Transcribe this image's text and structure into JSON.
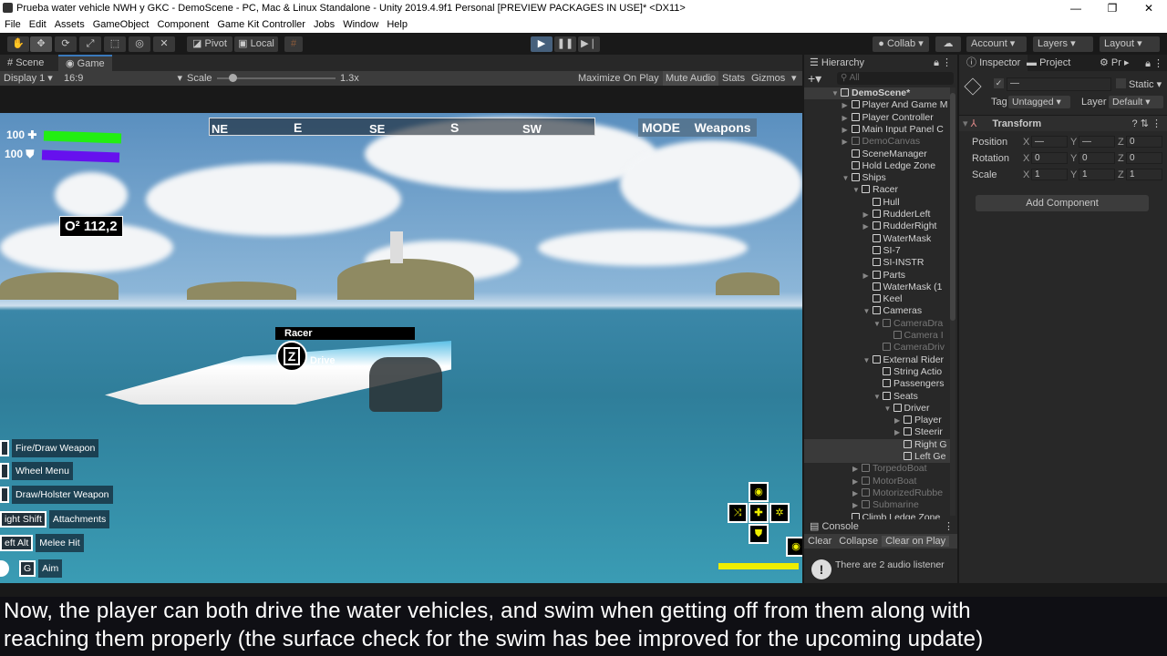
{
  "window": {
    "title": "Prueba water vehicle NWH y GKC - DemoScene - PC, Mac & Linux Standalone - Unity 2019.4.9f1 Personal [PREVIEW PACKAGES IN USE]* <DX11>",
    "minimize": "—",
    "maximize": "❐",
    "close": "✕"
  },
  "menu": [
    "File",
    "Edit",
    "Assets",
    "GameObject",
    "Component",
    "Game Kit Controller",
    "Jobs",
    "Window",
    "Help"
  ],
  "toolbar": {
    "pivot": "Pivot",
    "local": "Local",
    "collab": "Collab",
    "account": "Account",
    "layers": "Layers",
    "layout": "Layout"
  },
  "tabs": {
    "scene": "Scene",
    "game": "Game"
  },
  "gamebar": {
    "display": "Display 1",
    "aspect": "16:9",
    "scale_label": "Scale",
    "scale_value": "1.3x",
    "scale_fraction": 0.1,
    "maximize": "Maximize On Play",
    "mute": "Mute Audio",
    "stats": "Stats",
    "gizmos": "Gizmos"
  },
  "hud": {
    "health": "100",
    "shield": "100",
    "health_fill": 1.0,
    "shield_fill": 1.0,
    "oxygen": "O² 112,2",
    "compass": [
      "NE",
      "E",
      "SE",
      "S",
      "SW"
    ],
    "mode_label": "MODE",
    "mode_value": "Weapons",
    "vehicle_name": "Racer",
    "interact_key": "Z",
    "interact_label": "Drive",
    "hints": [
      {
        "key": "",
        "label": "Fire/Draw Weapon"
      },
      {
        "key": "",
        "label": "Wheel Menu"
      },
      {
        "key": "",
        "label": "Draw/Holster Weapon"
      },
      {
        "key": "ight Shift",
        "label": "Attachments"
      },
      {
        "key": "eft Alt",
        "label": "Melee Hit"
      },
      {
        "key": "G",
        "label": "Aim"
      }
    ],
    "colors": {
      "health": "#22ee11",
      "shield": "#6611ee",
      "stamina": "#eeee00"
    }
  },
  "hierarchy": {
    "title": "Hierarchy",
    "search": "All",
    "items": [
      {
        "label": "DemoScene*",
        "depth": 0,
        "arrow": "▼",
        "dim": false
      },
      {
        "label": "Player And Game M",
        "depth": 1,
        "arrow": "▶"
      },
      {
        "label": "Player Controller",
        "depth": 1,
        "arrow": "▶"
      },
      {
        "label": "Main Input Panel C",
        "depth": 1,
        "arrow": "▶"
      },
      {
        "label": "DemoCanvas",
        "depth": 1,
        "arrow": "▶",
        "dim": true
      },
      {
        "label": "SceneManager",
        "depth": 1,
        "arrow": ""
      },
      {
        "label": "Hold Ledge Zone",
        "depth": 1,
        "arrow": ""
      },
      {
        "label": "Ships",
        "depth": 1,
        "arrow": "▼"
      },
      {
        "label": "Racer",
        "depth": 2,
        "arrow": "▼"
      },
      {
        "label": "Hull",
        "depth": 3,
        "arrow": ""
      },
      {
        "label": "RudderLeft",
        "depth": 3,
        "arrow": "▶"
      },
      {
        "label": "RudderRight",
        "depth": 3,
        "arrow": "▶"
      },
      {
        "label": "WaterMask",
        "depth": 3,
        "arrow": ""
      },
      {
        "label": "SI-7",
        "depth": 3,
        "arrow": ""
      },
      {
        "label": "SI-INSTR",
        "depth": 3,
        "arrow": ""
      },
      {
        "label": "Parts",
        "depth": 3,
        "arrow": "▶"
      },
      {
        "label": "WaterMask (1",
        "depth": 3,
        "arrow": ""
      },
      {
        "label": "Keel",
        "depth": 3,
        "arrow": ""
      },
      {
        "label": "Cameras",
        "depth": 3,
        "arrow": "▼"
      },
      {
        "label": "CameraDra",
        "depth": 4,
        "arrow": "▼",
        "dim": true
      },
      {
        "label": "Camera I",
        "depth": 5,
        "arrow": "",
        "dim": true
      },
      {
        "label": "CameraDriv",
        "depth": 4,
        "arrow": "",
        "dim": true
      },
      {
        "label": "External Rider",
        "depth": 3,
        "arrow": "▼"
      },
      {
        "label": "String Actio",
        "depth": 4,
        "arrow": ""
      },
      {
        "label": "Passengers",
        "depth": 4,
        "arrow": ""
      },
      {
        "label": "Seats",
        "depth": 4,
        "arrow": "▼"
      },
      {
        "label": "Driver",
        "depth": 5,
        "arrow": "▼"
      },
      {
        "label": "Player",
        "depth": 6,
        "arrow": "▶"
      },
      {
        "label": "Steerir",
        "depth": 6,
        "arrow": "▶"
      },
      {
        "label": "Right G",
        "depth": 6,
        "arrow": "",
        "sel": true
      },
      {
        "label": "Left Ge",
        "depth": 6,
        "arrow": "",
        "sel": true
      },
      {
        "label": "TorpedoBoat",
        "depth": 2,
        "arrow": "▶",
        "dim": true
      },
      {
        "label": "MotorBoat",
        "depth": 2,
        "arrow": "▶",
        "dim": true
      },
      {
        "label": "MotorizedRubbe",
        "depth": 2,
        "arrow": "▶",
        "dim": true
      },
      {
        "label": "Submarine",
        "depth": 2,
        "arrow": "▶",
        "dim": true
      },
      {
        "label": "Climb Ledge Zone",
        "depth": 1,
        "arrow": ""
      }
    ]
  },
  "console": {
    "title": "Console",
    "clear": "Clear",
    "collapse": "Collapse",
    "clear_on_play": "Clear on Play",
    "message": "There are 2 audio listener"
  },
  "inspector": {
    "tabs": [
      "Inspector",
      "Project",
      "Pr"
    ],
    "name": "—",
    "static": "Static",
    "tag_label": "Tag",
    "tag": "Untagged",
    "layer_label": "Layer",
    "layer": "Default",
    "component": "Transform",
    "rows": [
      {
        "label": "Position",
        "x": "—",
        "y": "—",
        "z": "0"
      },
      {
        "label": "Rotation",
        "x": "0",
        "y": "0",
        "z": "0"
      },
      {
        "label": "Scale",
        "x": "1",
        "y": "1",
        "z": "1"
      }
    ],
    "add_component": "Add Component"
  },
  "subtitles": [
    "Now, the player can both drive the water vehicles, and swim when getting off from them along with",
    "reaching them properly (the surface check for the swim has bee improved for the upcoming update)"
  ]
}
